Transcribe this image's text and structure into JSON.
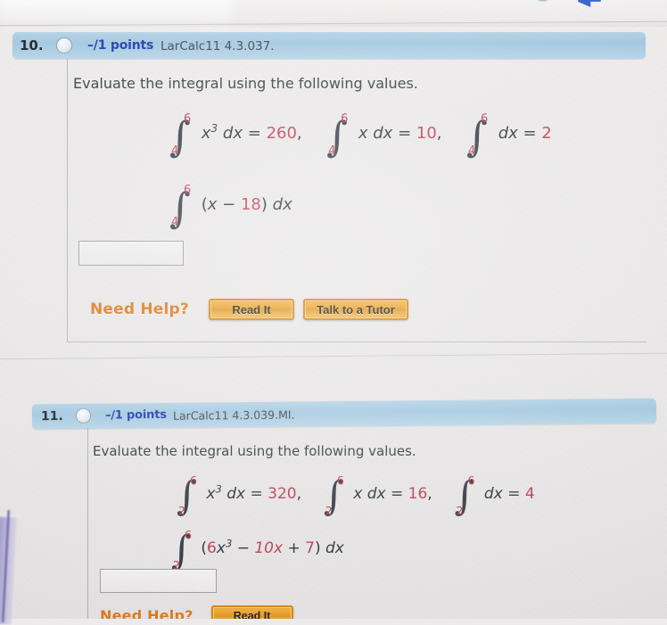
{
  "page": {
    "background_color": "#eceaea",
    "accent_header_color": "#a6cbe3",
    "points_color": "#1e3fb0",
    "value_color": "#c2415a",
    "help_label_color": "#e07b1e",
    "button_color": "#e79a24"
  },
  "questions": [
    {
      "number": "10.",
      "status_icon": "plus-circle-icon",
      "points": "–/1 points",
      "source_code": "LarCalc11 4.3.037.",
      "prompt": "Evaluate the integral using the following values.",
      "givens": [
        {
          "upper": "6",
          "lower": "4",
          "integrand_base": "x",
          "integrand_exp": "3",
          "differential": "dx",
          "equals": "=",
          "value": "260",
          "trailing": ","
        },
        {
          "upper": "6",
          "lower": "4",
          "integrand_base": "x",
          "integrand_exp": "",
          "differential": "dx",
          "equals": "=",
          "value": "10",
          "trailing": ","
        },
        {
          "upper": "6",
          "lower": "4",
          "integrand_base": "",
          "integrand_exp": "",
          "differential": "dx",
          "equals": "=",
          "value": "2",
          "trailing": ""
        }
      ],
      "target_integral": {
        "upper": "6",
        "lower": "4",
        "open_paren": "(",
        "var": "x",
        "operator": "−",
        "constant": "18",
        "close_paren": ")",
        "differential": "dx"
      },
      "answer_value": "",
      "need_help_label": "Need Help?",
      "buttons": [
        {
          "label": "Read It",
          "name": "read-it-button"
        },
        {
          "label": "Talk to a Tutor",
          "name": "talk-to-a-tutor-button"
        }
      ]
    },
    {
      "number": "11.",
      "status_icon": "plus-circle-icon",
      "points": "–/1 points",
      "source_code": "LarCalc11 4.3.039.MI.",
      "prompt": "Evaluate the integral using the following values.",
      "givens": [
        {
          "upper": "6",
          "lower": "2",
          "integrand_base": "x",
          "integrand_exp": "3",
          "differential": "dx",
          "equals": "=",
          "value": "320",
          "trailing": ","
        },
        {
          "upper": "6",
          "lower": "2",
          "integrand_base": "x",
          "integrand_exp": "",
          "differential": "dx",
          "equals": "=",
          "value": "16",
          "trailing": ","
        },
        {
          "upper": "6",
          "lower": "2",
          "integrand_base": "",
          "integrand_exp": "",
          "differential": "dx",
          "equals": "=",
          "value": "4",
          "trailing": ""
        }
      ],
      "target_integral": {
        "upper": "6",
        "lower": "2",
        "open_paren": "(",
        "coefficient": "6",
        "var": "x",
        "exponent": "3",
        "operator1": "−",
        "term2": "10x",
        "operator2": "+",
        "term3": "7",
        "close_paren": ")",
        "differential": "dx"
      },
      "answer_value": "",
      "need_help_label": "Need Help?"
    }
  ]
}
